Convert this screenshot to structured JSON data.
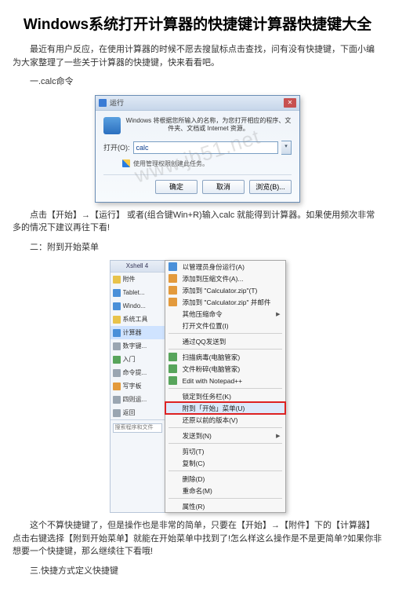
{
  "title": "Windows系统打开计算器的快捷键计算器快捷键大全",
  "intro": "最近有用户反应，在使用计算器的时候不愿去搜鼠标点击查找，问有没有快捷键，下面小编为大家整理了一些关于计算器的快捷键，快来看看吧。",
  "sec1": "一.calc命令",
  "run": {
    "title": "运行",
    "desc": "Windows 将根据您所输入的名称，为您打开相应的程序、文件夹、文档或 Internet 资源。",
    "open_label": "打开(O):",
    "value": "calc",
    "admin": "使用管理权限创建此任务。",
    "ok": "确定",
    "cancel": "取消",
    "browse": "浏览(B)...",
    "watermark": "www.jb51.net"
  },
  "p1": "点击【开始】→【运行】 或者(组合键Win+R)输入calc 就能得到计算器。如果使用频次非常多的情况下建议再往下看!",
  "sec2": "二：附到开始菜单",
  "left": {
    "hdr": "Xshell 4",
    "items": [
      {
        "label": "附件",
        "cls": "c-yellow"
      },
      {
        "label": "Tablet...",
        "cls": "c-blue"
      },
      {
        "label": "Windo...",
        "cls": "c-blue"
      },
      {
        "label": "系统工具",
        "cls": "c-yellow"
      },
      {
        "label": "计算器",
        "cls": "c-blue",
        "sel": true
      },
      {
        "label": "数字键...",
        "cls": "c-gray"
      },
      {
        "label": "入门",
        "cls": "c-green"
      },
      {
        "label": "命令提...",
        "cls": "c-gray"
      },
      {
        "label": "写字板",
        "cls": "c-orange"
      },
      {
        "label": "四则运...",
        "cls": "c-gray"
      }
    ],
    "back": "返回",
    "search_ph": "搜索程序和文件"
  },
  "menu": {
    "items": [
      {
        "label": "以管理员身份运行(A)",
        "icon": "c-blue"
      },
      {
        "label": "添加到压缩文件(A)...",
        "icon": "c-orange"
      },
      {
        "label": "添加到 \"Calculator.zip\"(T)",
        "icon": "c-orange"
      },
      {
        "label": "添加到 \"Calculator.zip\" 并邮件",
        "icon": "c-orange"
      },
      {
        "label": "其他压缩命令",
        "arrow": true
      },
      {
        "label": "打开文件位置(I)"
      },
      {
        "sep": true
      },
      {
        "label": "通过QQ发送到"
      },
      {
        "sep": true
      },
      {
        "label": "扫描病毒(电脑管家)",
        "icon": "c-green"
      },
      {
        "label": "文件粉碎(电脑管家)",
        "icon": "c-green"
      },
      {
        "label": "Edit with Notepad++",
        "icon": "c-green"
      },
      {
        "sep": true
      },
      {
        "label": "锁定到任务栏(K)"
      },
      {
        "label": "附到「开始」菜单(U)",
        "hi": true
      },
      {
        "label": "还原以前的版本(V)"
      },
      {
        "sep": true
      },
      {
        "label": "发送到(N)",
        "arrow": true
      },
      {
        "sep": true
      },
      {
        "label": "剪切(T)"
      },
      {
        "label": "复制(C)"
      },
      {
        "sep": true
      },
      {
        "label": "删除(D)"
      },
      {
        "label": "重命名(M)"
      },
      {
        "sep": true
      },
      {
        "label": "属性(R)"
      }
    ]
  },
  "p2": "这个不算快捷键了，但是操作也是非常的简单，只要在【开始】→【附件】下的【计算器】点击右键选择【附到开始菜单】就能在开始菜单中找到了!怎么样这么操作是不是更简单?如果你非想要一个快捷键，那么继续往下看哦!",
  "sec3": "三.快捷方式定义快捷键"
}
